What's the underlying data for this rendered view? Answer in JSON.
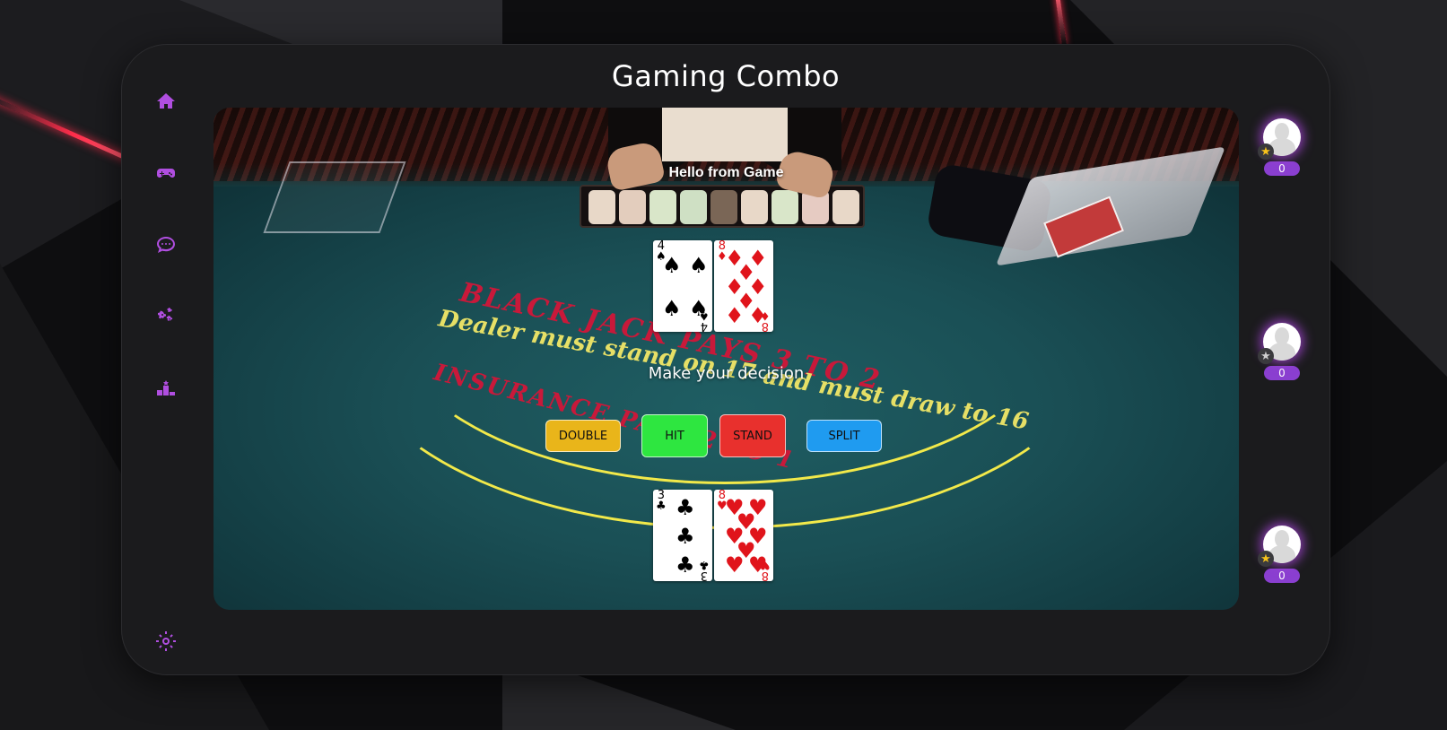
{
  "app": {
    "title": "Gaming Combo"
  },
  "sidebar": {
    "items": [
      {
        "icon": "home-icon"
      },
      {
        "icon": "gamepad-icon"
      },
      {
        "icon": "chat-icon"
      },
      {
        "icon": "gears-icon"
      },
      {
        "icon": "leaderboard-icon"
      }
    ],
    "bottom_icon": "settings-icon"
  },
  "game": {
    "greeting": "Hello from Game",
    "prompt": "Make your decision",
    "felt": {
      "line1": "BLACK JACK PAYS 3 TO 2",
      "line2": "Dealer must stand on 17 and must draw to 16",
      "line3": "INSURANCE PAYS 2 TO 1"
    },
    "dealer_hand": [
      {
        "rank": "4",
        "suit": "♠",
        "color": "black"
      },
      {
        "rank": "8",
        "suit": "♦",
        "color": "red"
      }
    ],
    "player_hand": [
      {
        "rank": "3",
        "suit": "♣",
        "color": "black"
      },
      {
        "rank": "8",
        "suit": "♥",
        "color": "red"
      }
    ],
    "actions": {
      "double": "DOUBLE",
      "hit": "HIT",
      "stand": "STAND",
      "split": "SPLIT"
    }
  },
  "players": [
    {
      "score": "0",
      "star": "gold"
    },
    {
      "score": "0",
      "star": "grey"
    },
    {
      "score": "0",
      "star": "gold"
    }
  ],
  "colors": {
    "accent": "#b04ee0",
    "double": "#e9b51a",
    "hit": "#2ee640",
    "stand": "#e8302d",
    "split": "#1f9bf0",
    "badge": "#8a3fd0"
  }
}
